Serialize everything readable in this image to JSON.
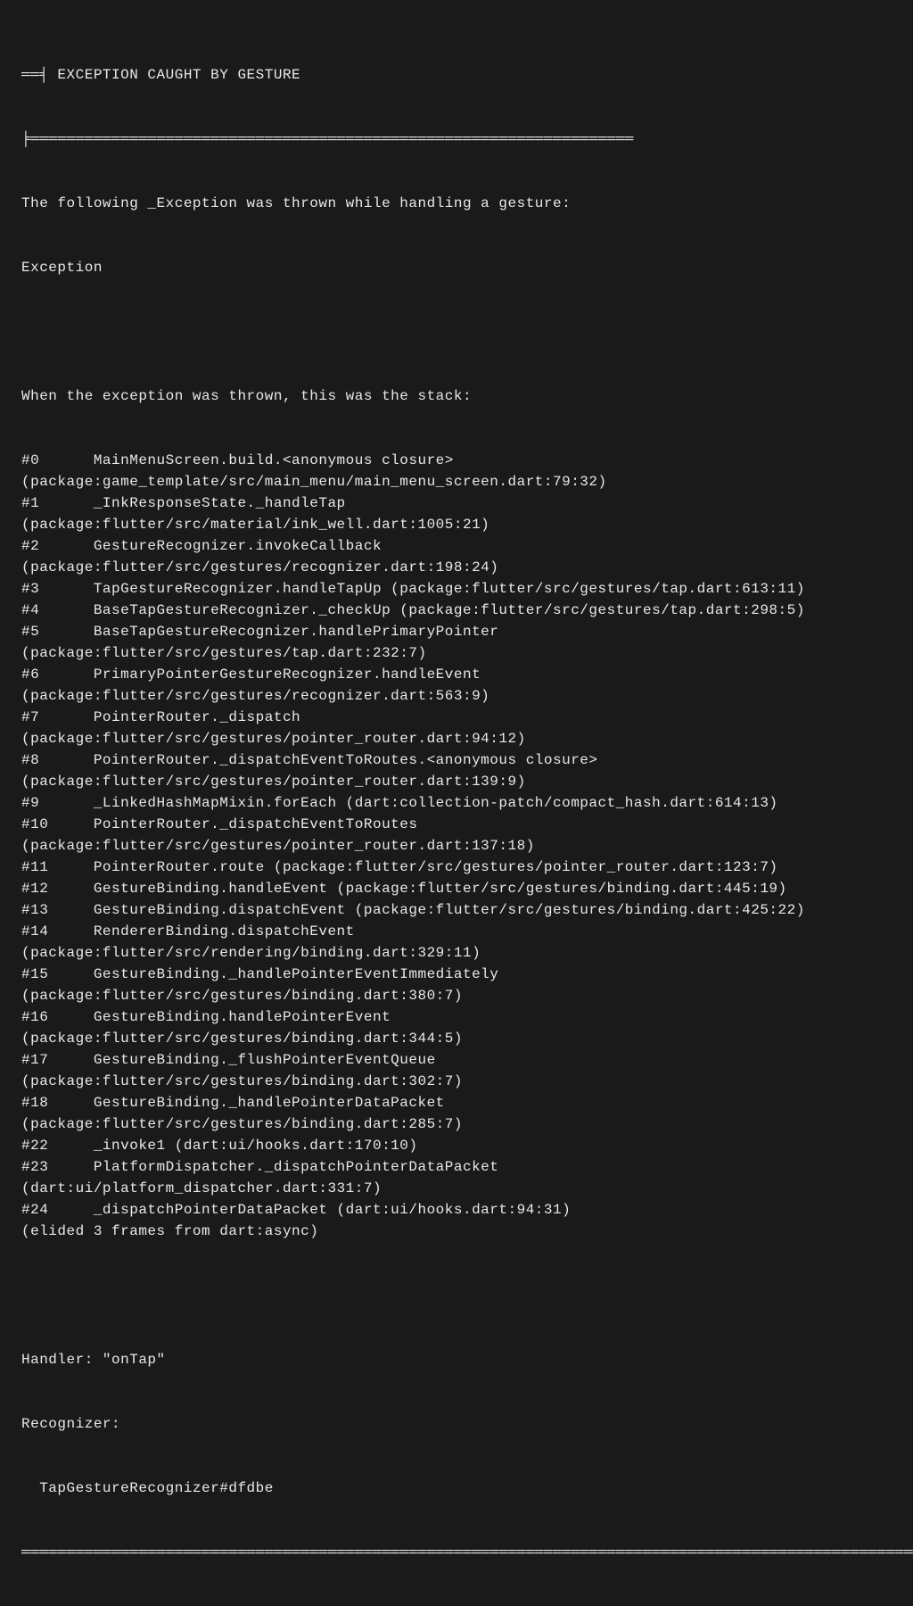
{
  "header": {
    "prefix": "══╡ ",
    "title": "EXCEPTION CAUGHT BY GESTURE",
    "divider_top": "╞═══════════════════════════════════════════════════════════════════"
  },
  "intro": {
    "line1": "The following _Exception was thrown while handling a gesture:",
    "line2": "Exception"
  },
  "stack_header": "When the exception was thrown, this was the stack:",
  "frames": [
    "#0      MainMenuScreen.build.<anonymous closure>",
    "(package:game_template/src/main_menu/main_menu_screen.dart:79:32)",
    "#1      _InkResponseState._handleTap",
    "(package:flutter/src/material/ink_well.dart:1005:21)",
    "#2      GestureRecognizer.invokeCallback",
    "(package:flutter/src/gestures/recognizer.dart:198:24)",
    "#3      TapGestureRecognizer.handleTapUp (package:flutter/src/gestures/tap.dart:613:11)",
    "#4      BaseTapGestureRecognizer._checkUp (package:flutter/src/gestures/tap.dart:298:5)",
    "#5      BaseTapGestureRecognizer.handlePrimaryPointer",
    "(package:flutter/src/gestures/tap.dart:232:7)",
    "#6      PrimaryPointerGestureRecognizer.handleEvent",
    "(package:flutter/src/gestures/recognizer.dart:563:9)",
    "#7      PointerRouter._dispatch",
    "(package:flutter/src/gestures/pointer_router.dart:94:12)",
    "#8      PointerRouter._dispatchEventToRoutes.<anonymous closure>",
    "(package:flutter/src/gestures/pointer_router.dart:139:9)",
    "#9      _LinkedHashMapMixin.forEach (dart:collection-patch/compact_hash.dart:614:13)",
    "#10     PointerRouter._dispatchEventToRoutes",
    "(package:flutter/src/gestures/pointer_router.dart:137:18)",
    "#11     PointerRouter.route (package:flutter/src/gestures/pointer_router.dart:123:7)",
    "#12     GestureBinding.handleEvent (package:flutter/src/gestures/binding.dart:445:19)",
    "#13     GestureBinding.dispatchEvent (package:flutter/src/gestures/binding.dart:425:22)",
    "#14     RendererBinding.dispatchEvent",
    "(package:flutter/src/rendering/binding.dart:329:11)",
    "#15     GestureBinding._handlePointerEventImmediately",
    "(package:flutter/src/gestures/binding.dart:380:7)",
    "#16     GestureBinding.handlePointerEvent",
    "(package:flutter/src/gestures/binding.dart:344:5)",
    "#17     GestureBinding._flushPointerEventQueue",
    "(package:flutter/src/gestures/binding.dart:302:7)",
    "#18     GestureBinding._handlePointerDataPacket",
    "(package:flutter/src/gestures/binding.dart:285:7)",
    "#22     _invoke1 (dart:ui/hooks.dart:170:10)",
    "#23     PlatformDispatcher._dispatchPointerDataPacket",
    "(dart:ui/platform_dispatcher.dart:331:7)",
    "#24     _dispatchPointerDataPacket (dart:ui/hooks.dart:94:31)",
    "(elided 3 frames from dart:async)"
  ],
  "footer": {
    "handler_line": "Handler: \"onTap\"",
    "recognizer_label": "Recognizer:",
    "recognizer_value": "  TapGestureRecognizer#dfdbe",
    "divider_bottom": "════════════════════════════════════════════════════════════════════════════════════════════════════"
  }
}
